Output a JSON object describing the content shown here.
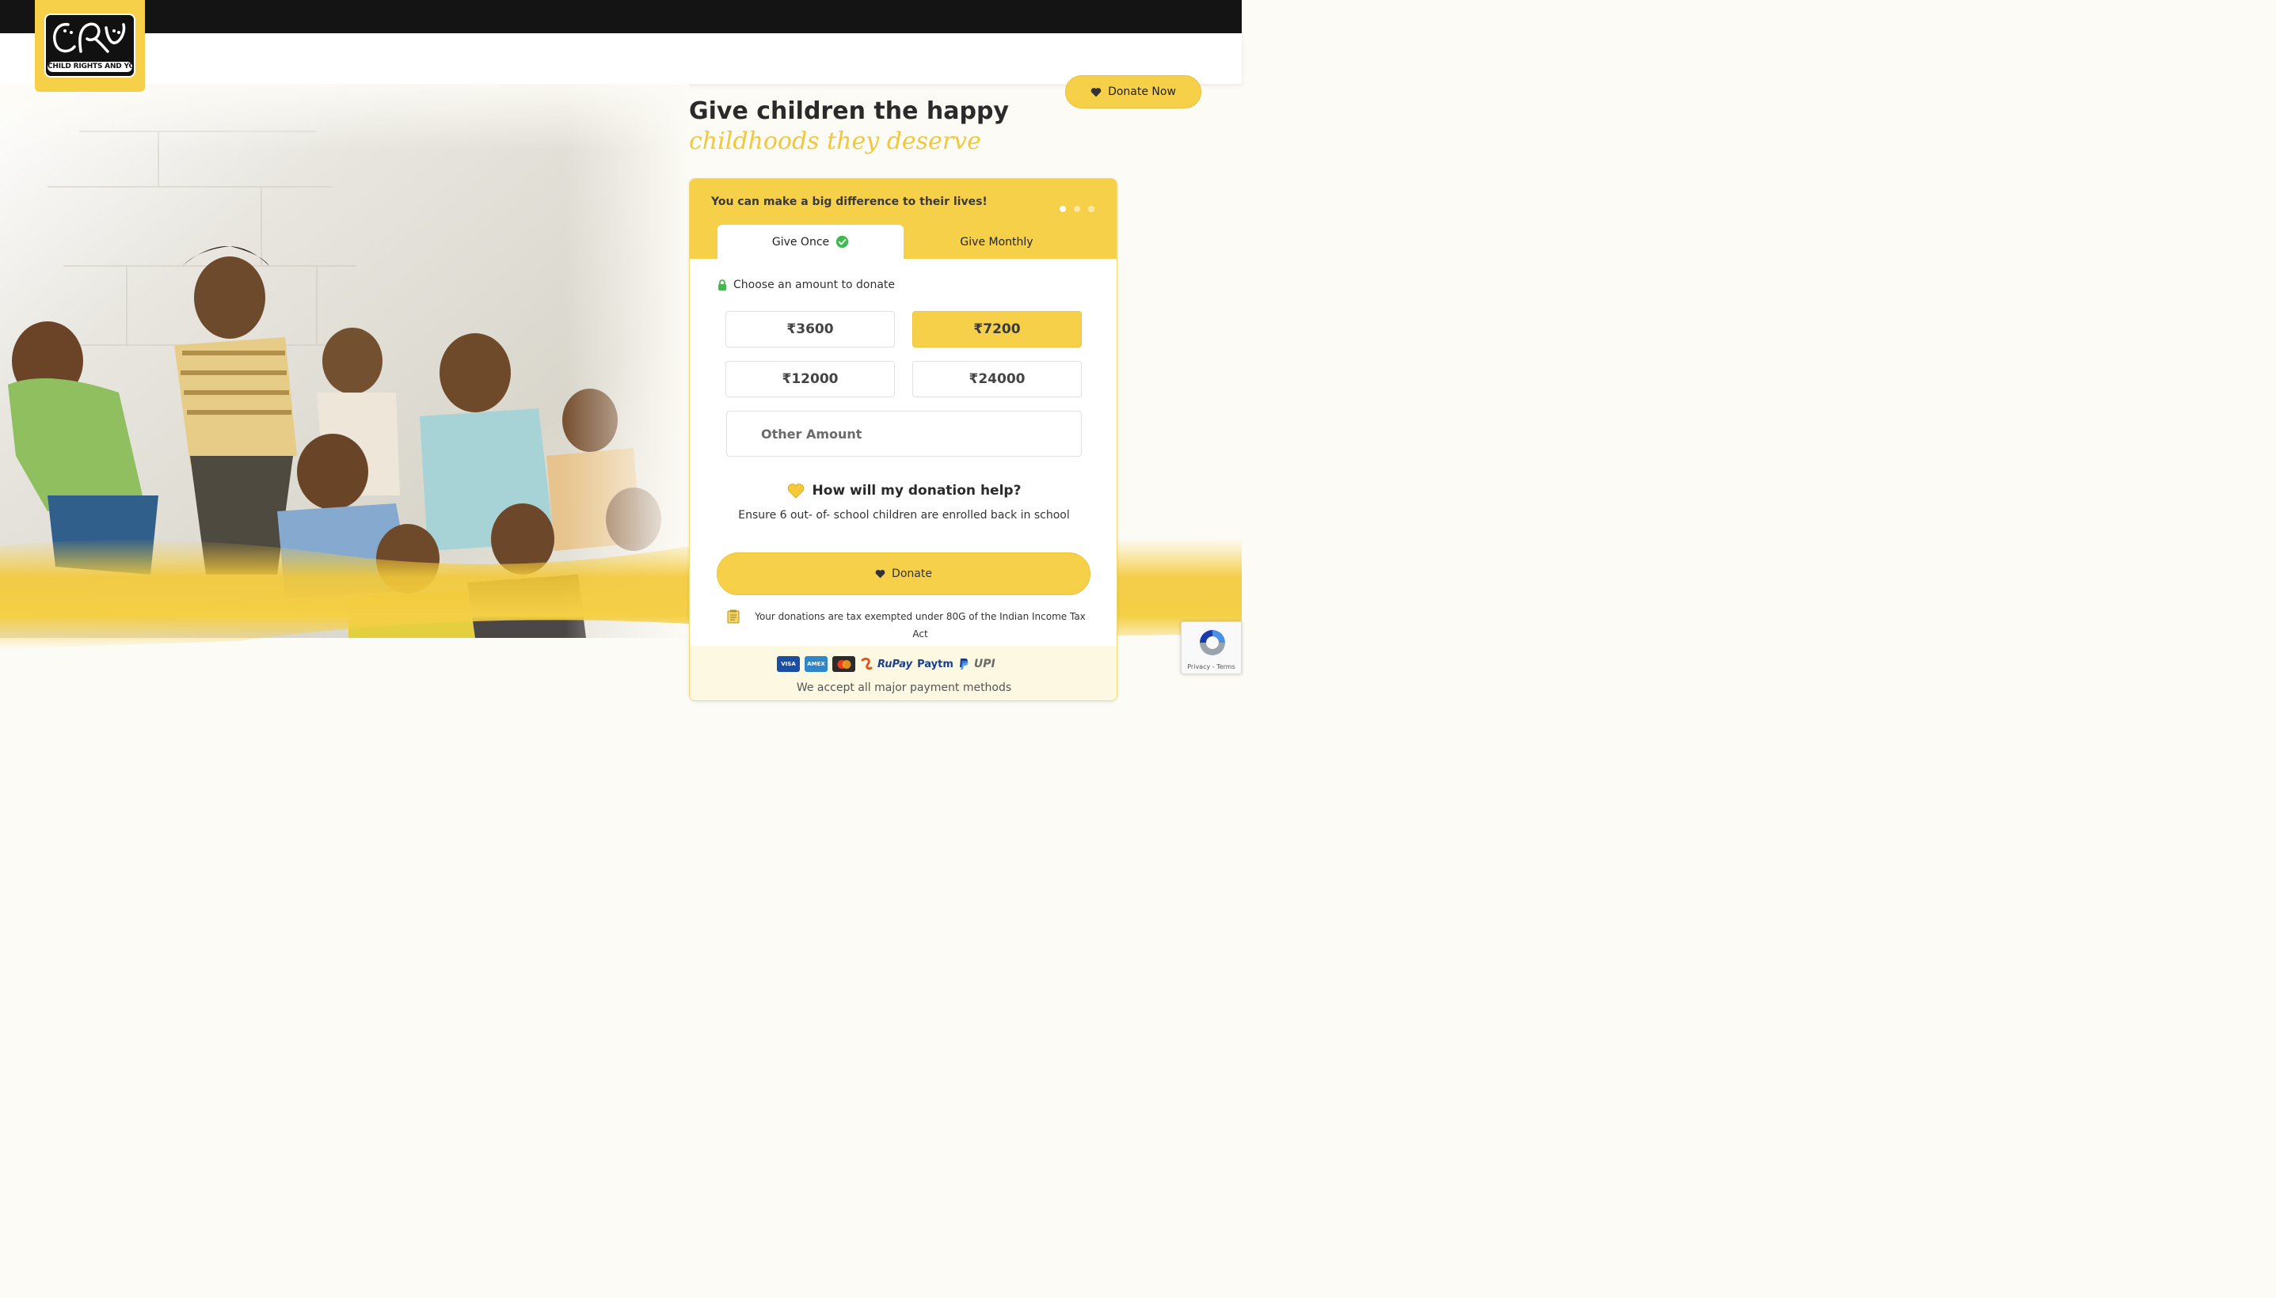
{
  "brand": {
    "logo_text": "CHILD RIGHTS AND YOU",
    "accent_color": "#f7d04a",
    "topbar_color": "#141414"
  },
  "header": {
    "donate_now_label": "Donate Now",
    "donate_now_icon": "heart-icon"
  },
  "hero": {
    "headline_main": "Give children the happy",
    "headline_accent": "childhoods they deserve"
  },
  "donation_card": {
    "tagline": "You can make a big difference to their lives!",
    "carousel_dots": 3,
    "carousel_active_index": 0,
    "tabs": [
      {
        "label": "Give Once",
        "selected": true,
        "icon": "check-circle-icon"
      },
      {
        "label": "Give Monthly",
        "selected": false
      }
    ],
    "choose_label": "Choose an amount to donate",
    "choose_icon": "lock-icon",
    "amounts": [
      {
        "label": "₹3600",
        "selected": false
      },
      {
        "label": "₹7200",
        "selected": true
      },
      {
        "label": "₹12000",
        "selected": false
      },
      {
        "label": "₹24000",
        "selected": false
      }
    ],
    "other_amount_placeholder": "Other Amount",
    "impact_title": "How will my donation help?",
    "impact_icon": "yellow-heart-icon",
    "impact_text": "Ensure 6 out- of- school children are enrolled back in school",
    "donate_label": "Donate",
    "tax_note": "Your donations are tax exempted under 80G of the Indian Income Tax Act",
    "tax_icon": "notepad-icon",
    "payment_methods": [
      "VISA",
      "AMEX",
      "Mastercard",
      "RuPay",
      "Paytm",
      "PayPal",
      "UPI"
    ],
    "payment_caption": "We accept all major payment methods"
  },
  "recaptcha": {
    "label": "Privacy - Terms"
  }
}
